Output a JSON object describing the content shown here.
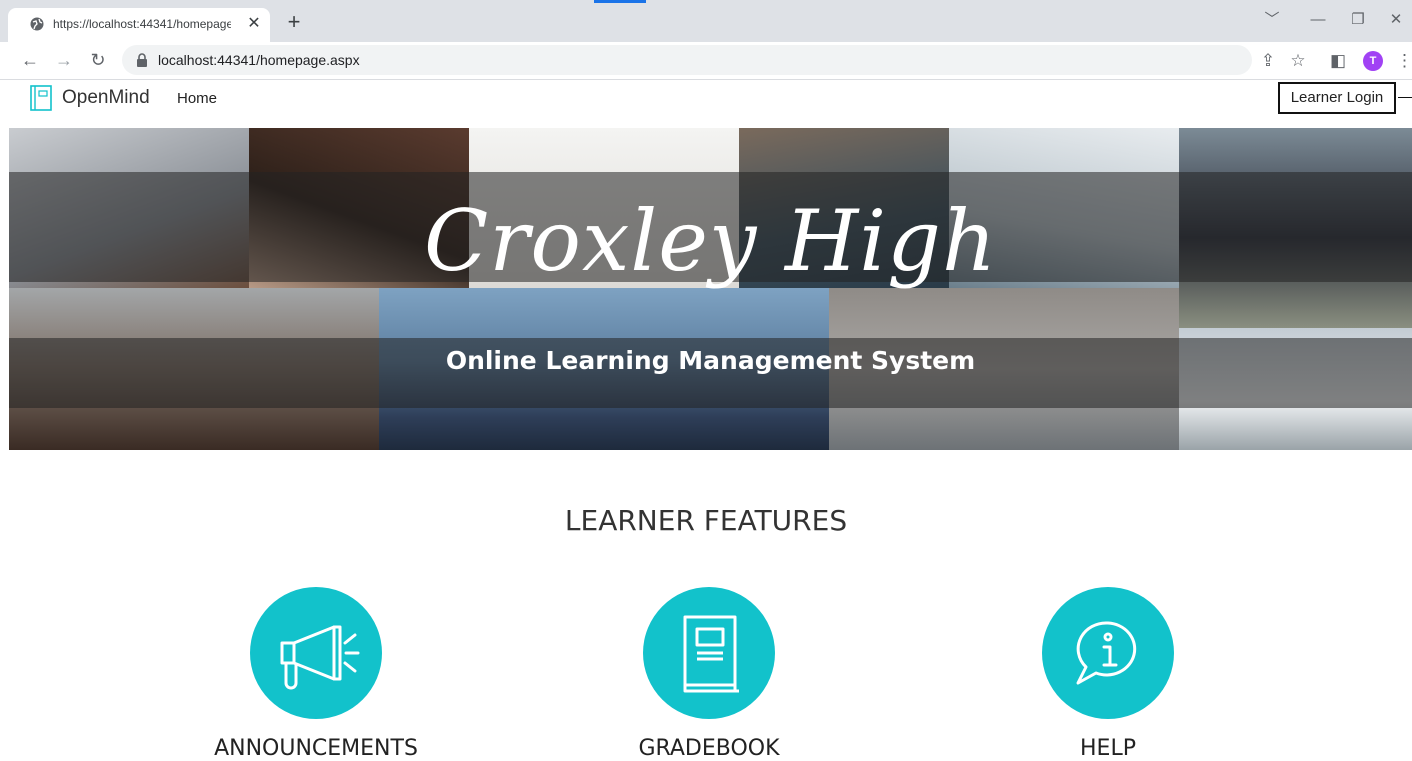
{
  "browser": {
    "tab_title": "https://localhost:44341/homepage.aspx",
    "url": "localhost:44341/homepage.aspx",
    "profile_initial": "T"
  },
  "navbar": {
    "brand": "OpenMind",
    "home": "Home",
    "login": "Learner Login"
  },
  "hero": {
    "title": "Croxley High",
    "subtitle": "Online Learning Management System"
  },
  "features": {
    "title": "LEARNER FEATURES",
    "items": [
      {
        "label": "ANNOUNCEMENTS",
        "icon": "megaphone-icon"
      },
      {
        "label": "GRADEBOOK",
        "icon": "book-icon"
      },
      {
        "label": "HELP",
        "icon": "info-bubble-icon"
      }
    ]
  },
  "colors": {
    "accent": "#12c2cb",
    "browser_frame": "#dee1e6"
  }
}
